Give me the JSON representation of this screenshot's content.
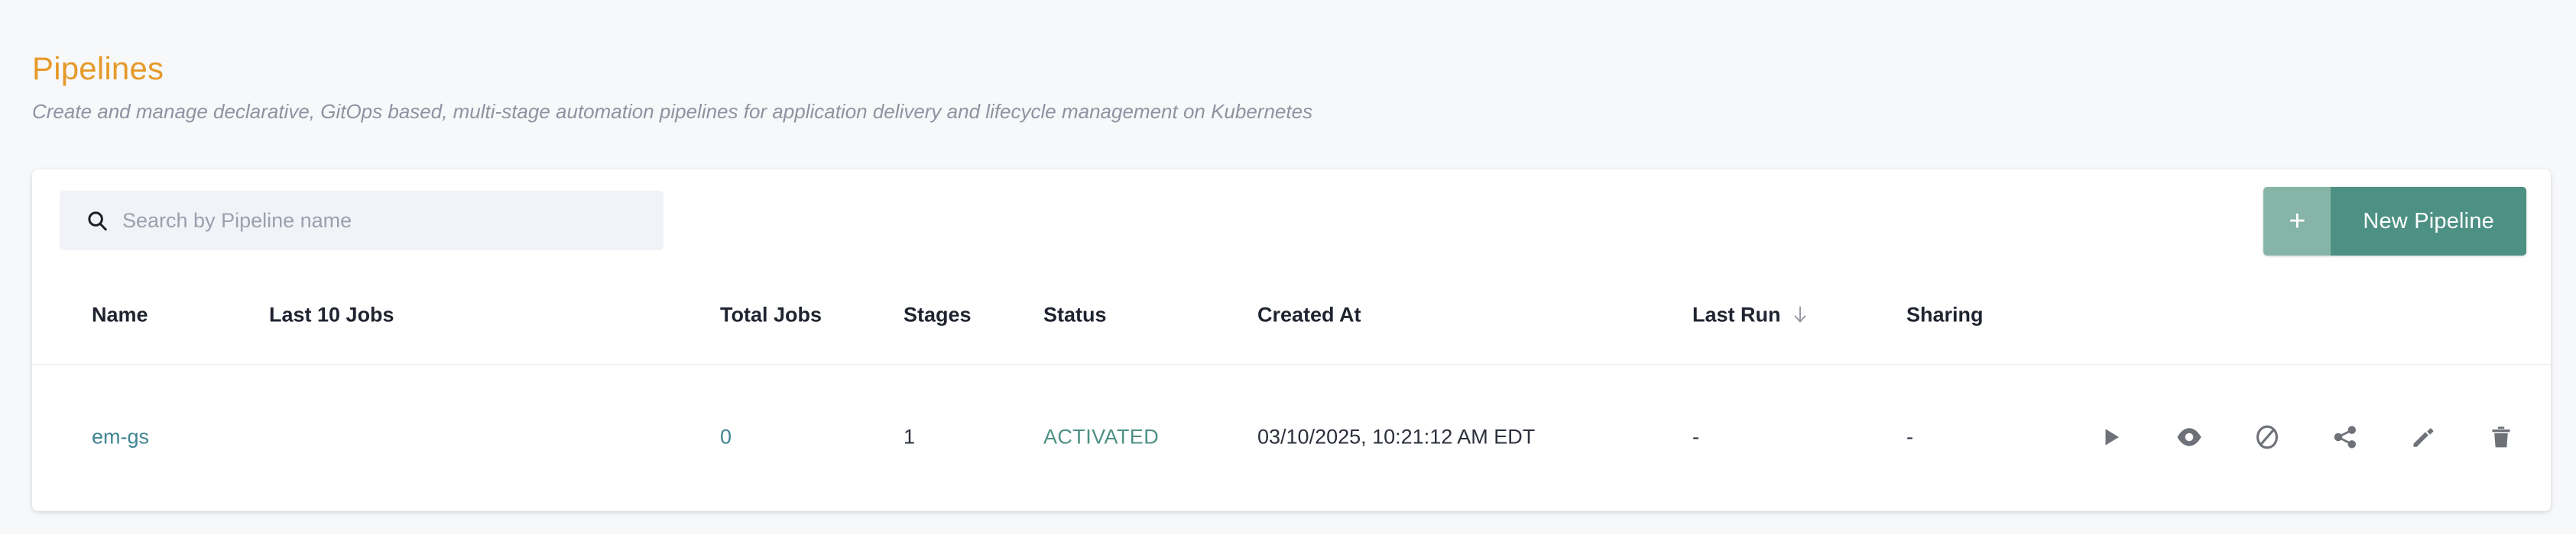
{
  "header": {
    "title": "Pipelines",
    "subtitle": "Create and manage declarative, GitOps based, multi-stage automation pipelines for application delivery and lifecycle management on Kubernetes"
  },
  "toolbar": {
    "search": {
      "placeholder": "Search by Pipeline name",
      "value": "",
      "icon": "search-icon"
    },
    "new_pipeline": {
      "plus_label": "+",
      "label": "New Pipeline"
    }
  },
  "table": {
    "columns": [
      {
        "key": "name",
        "label": "Name",
        "sorted": false
      },
      {
        "key": "last_10_jobs",
        "label": "Last 10 Jobs",
        "sorted": false
      },
      {
        "key": "total_jobs",
        "label": "Total Jobs",
        "sorted": false
      },
      {
        "key": "stages",
        "label": "Stages",
        "sorted": false
      },
      {
        "key": "status",
        "label": "Status",
        "sorted": false
      },
      {
        "key": "created_at",
        "label": "Created At",
        "sorted": false
      },
      {
        "key": "last_run",
        "label": "Last Run",
        "sorted": true,
        "sort_direction": "desc"
      },
      {
        "key": "sharing",
        "label": "Sharing",
        "sorted": false
      }
    ],
    "rows": [
      {
        "name": "em-gs",
        "last_10_jobs": "",
        "total_jobs": "0",
        "stages": "1",
        "status": "ACTIVATED",
        "created_at": "03/10/2025, 10:21:12 AM EDT",
        "last_run": "-",
        "sharing": "-"
      }
    ],
    "row_actions": [
      {
        "name": "run-pipeline-icon",
        "label": "Run"
      },
      {
        "name": "view-pipeline-icon",
        "label": "View"
      },
      {
        "name": "disable-pipeline-icon",
        "label": "Disable"
      },
      {
        "name": "share-pipeline-icon",
        "label": "Share"
      },
      {
        "name": "edit-pipeline-icon",
        "label": "Edit"
      },
      {
        "name": "delete-pipeline-icon",
        "label": "Delete"
      }
    ]
  },
  "colors": {
    "title": "#e59a29",
    "accent_green": "#4d9184",
    "accent_green_light": "#86b4a7",
    "link_teal": "#3f8491",
    "page_background": "#f7f8fa",
    "card_background": "#ffffff",
    "search_background": "#f1f3f8",
    "subtitle_text": "#8d93a1"
  }
}
